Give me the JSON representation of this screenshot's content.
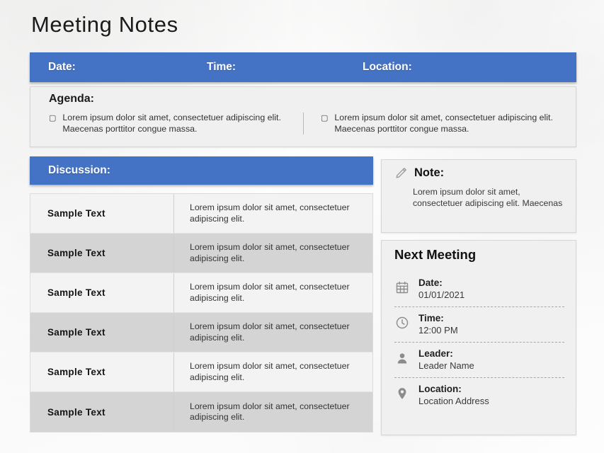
{
  "page": {
    "title": "Meeting Notes",
    "accent_color": "#4472C4",
    "panel_background": "#f0f0f0",
    "row_color_odd": "#f3f3f3",
    "row_color_even": "#d4d4d4"
  },
  "header_bar": {
    "date_label": "Date:",
    "time_label": "Time:",
    "location_label": "Location:"
  },
  "agenda": {
    "title": "Agenda:",
    "bullet_glyph": "▢",
    "items": [
      "Lorem ipsum dolor sit amet, consectetuer adipiscing elit. Maecenas porttitor congue massa.",
      "Lorem ipsum dolor sit amet, consectetuer adipiscing elit. Maecenas porttitor congue massa."
    ]
  },
  "discussion": {
    "title": "Discussion:",
    "rows": [
      {
        "label": "Sample Text",
        "text": "Lorem ipsum dolor sit amet, consectetuer adipiscing elit."
      },
      {
        "label": "Sample Text",
        "text": "Lorem ipsum dolor sit amet, consectetuer adipiscing elit."
      },
      {
        "label": "Sample Text",
        "text": "Lorem ipsum dolor sit amet, consectetuer adipiscing elit."
      },
      {
        "label": "Sample Text",
        "text": "Lorem ipsum dolor sit amet, consectetuer adipiscing elit."
      },
      {
        "label": "Sample Text",
        "text": "Lorem ipsum dolor sit amet, consectetuer adipiscing elit."
      },
      {
        "label": "Sample Text",
        "text": "Lorem ipsum dolor sit amet, consectetuer adipiscing elit."
      }
    ]
  },
  "note": {
    "icon": "pencil-icon",
    "title": "Note:",
    "body": "Lorem ipsum dolor sit amet, consectetuer adipiscing elit. Maecenas"
  },
  "next_meeting": {
    "title": "Next Meeting",
    "items": [
      {
        "icon": "calendar-icon",
        "label": "Date:",
        "value": "01/01/2021"
      },
      {
        "icon": "clock-icon",
        "label": "Time:",
        "value": "12:00 PM"
      },
      {
        "icon": "person-icon",
        "label": "Leader:",
        "value": "Leader Name"
      },
      {
        "icon": "map-pin-icon",
        "label": "Location:",
        "value": "Location Address"
      }
    ]
  }
}
